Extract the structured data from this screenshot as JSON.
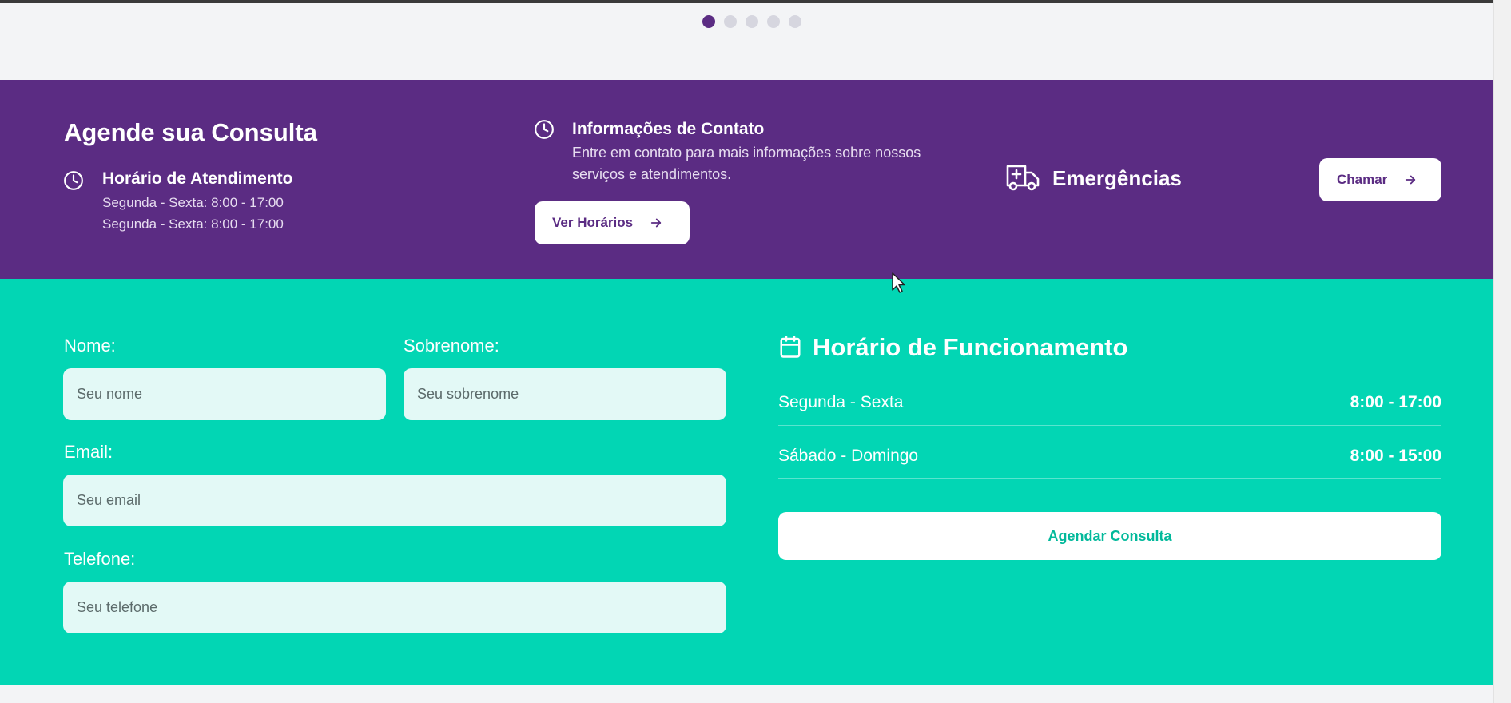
{
  "carousel": {
    "dots": 5,
    "active_index": 0
  },
  "appointment": {
    "title": "Agende sua Consulta",
    "hours_heading": "Horário de Atendimento",
    "hours_lines": [
      "Segunda - Sexta: 8:00 - 17:00",
      "Segunda - Sexta: 8:00 - 17:00"
    ]
  },
  "contact": {
    "heading": "Informações de Contato",
    "description": "Entre em contato para mais informações sobre nossos serviços e atendimentos.",
    "button_label": "Ver Horários"
  },
  "emergency": {
    "label": "Emergências",
    "button_label": "Chamar"
  },
  "form": {
    "first_name": {
      "label": "Nome:",
      "placeholder": "Seu nome",
      "value": ""
    },
    "last_name": {
      "label": "Sobrenome:",
      "placeholder": "Seu sobrenome",
      "value": ""
    },
    "email": {
      "label": "Email:",
      "placeholder": "Seu email",
      "value": ""
    },
    "phone": {
      "label": "Telefone:",
      "placeholder": "Seu telefone",
      "value": ""
    }
  },
  "opening_hours": {
    "title": "Horário de Funcionamento",
    "rows": [
      {
        "days": "Segunda - Sexta",
        "time": "8:00 - 17:00"
      },
      {
        "days": "Sábado - Domingo",
        "time": "8:00 - 15:00"
      }
    ],
    "button_label": "Agendar Consulta"
  },
  "colors": {
    "purple": "#5b2c83",
    "teal": "#02d6b4",
    "teal_text": "#02b99b",
    "input_bg": "#e3f9f6"
  },
  "icons": [
    "clock-icon",
    "ambulance-icon",
    "arrow-right-icon",
    "calendar-icon",
    "mouse-cursor-icon"
  ]
}
